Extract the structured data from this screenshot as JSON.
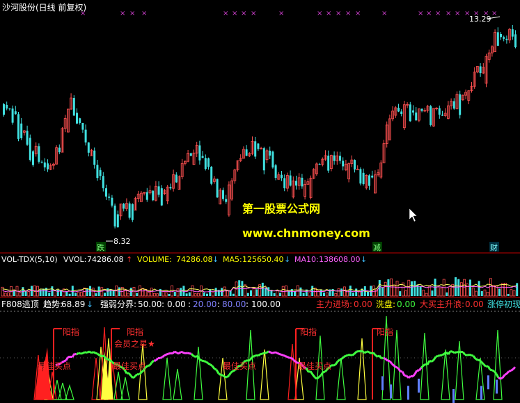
{
  "title": "沙河股份(日线 前复权)",
  "price_panel": {
    "high_label": "13.29",
    "low_label": "8.32",
    "markers": [
      "跌",
      "减",
      "财"
    ],
    "watermark_line1": "第一股票公式网",
    "watermark_line2": "www.chnmoney.com",
    "colors": {
      "up": "#ff5050",
      "down": "#40e0e0",
      "bg": "#000000",
      "divider": "#c00000"
    }
  },
  "volume_panel": {
    "header": {
      "vol_tdx": "VOL-TDX(5,10)",
      "vvol_label": "VVOL:",
      "vvol_value": "74286.08",
      "volume_label": "VOLUME:",
      "volume_value": "74286.08",
      "ma5_label": "MA5:",
      "ma5_value": "125650.40",
      "ma10_label": "MA10:",
      "ma10_value": "138608.00"
    }
  },
  "indicator_panel": {
    "header": {
      "name": "F808逃顶",
      "trend_label": "趋势:",
      "trend_value": "68.89",
      "strength_label": "强弱分界:",
      "strength_values": [
        "50.00",
        "0.00",
        "20.00",
        "80.00",
        "100.00"
      ],
      "main_label": "主力进场:",
      "main_value": "0.00",
      "wash_label": "洗盘:",
      "wash_value": "0.00",
      "big_buy_label": "大买主升浪:",
      "big_buy_value": "0.00",
      "limit_up_label": "涨停初现"
    },
    "annotations": [
      "阳指",
      "阳指",
      "最佳买点",
      "最佳买点",
      "会员之星★",
      "最佳买点",
      "阳指",
      "最佳买点",
      "阳指"
    ]
  }
}
